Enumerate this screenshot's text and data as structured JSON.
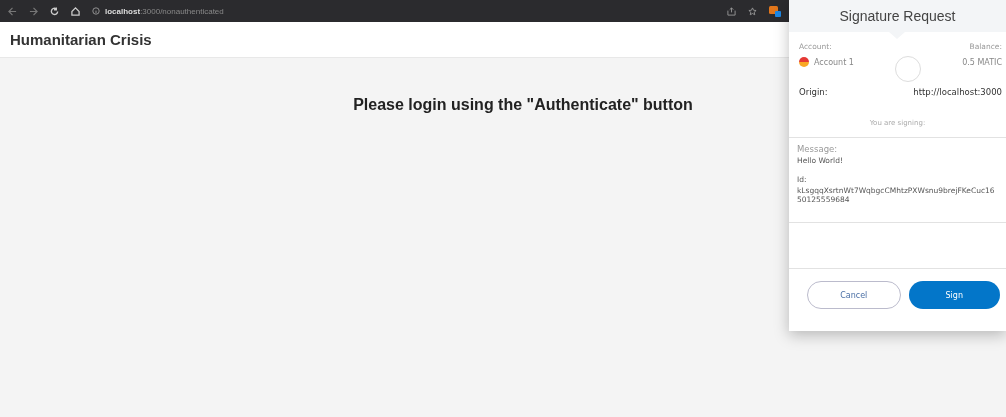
{
  "browser": {
    "url": "**localhost**:3000/nonauthenticated"
  },
  "app": {
    "title": "Humanitarian Crisis",
    "message": "Please login using the \"Authenticate\" button"
  },
  "signature_popup": {
    "title": "Signature Request",
    "account_label": "Account:",
    "balance_label": "Balance:",
    "account_name": "Account 1",
    "balance": "0.5 MATIC",
    "origin_label": "Origin:",
    "origin": "http://localhost:3000",
    "signing_label": "You are signing:",
    "message_label": "Message:",
    "message": "Hello World!",
    "id_label": "Id:",
    "id": "kLsgqqXsrtnWt7WqbgcCMhtzPXWsnu9brejFKeCuc1650125559684",
    "buttons": [
      {
        "label": "Cancel",
        "kind": "secondary"
      },
      {
        "label": "Sign",
        "kind": "primary"
      }
    ]
  }
}
